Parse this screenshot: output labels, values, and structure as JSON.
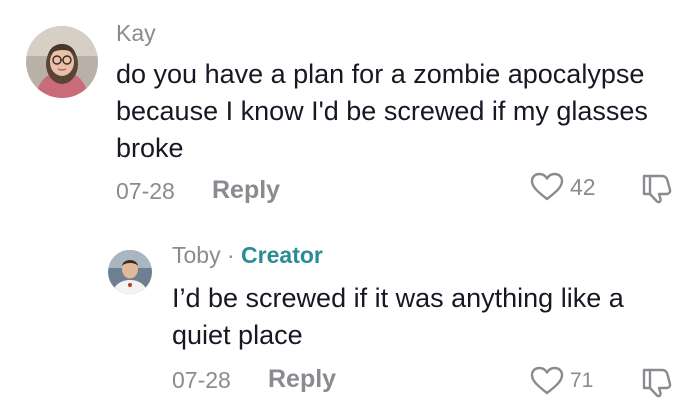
{
  "comments": [
    {
      "author": "Kay",
      "text": "do you have a plan for a zombie apocalypse because I know I'd be screwed if my glasses broke",
      "date": "07-28",
      "reply_label": "Reply",
      "likes": "42",
      "avatar_icon": "user-avatar-woman-glasses"
    },
    {
      "author": "Toby",
      "separator": "·",
      "badge": "Creator",
      "text": "I’d be screwed if it was anything like a quiet place",
      "date": "07-28",
      "reply_label": "Reply",
      "likes": "71",
      "avatar_icon": "user-avatar-man"
    }
  ],
  "icons": {
    "like": "heart-outline-icon",
    "dislike": "thumbs-down-icon"
  },
  "colors": {
    "text": "#161823",
    "secondary": "#8a8b91",
    "creator": "#2a8c96"
  }
}
